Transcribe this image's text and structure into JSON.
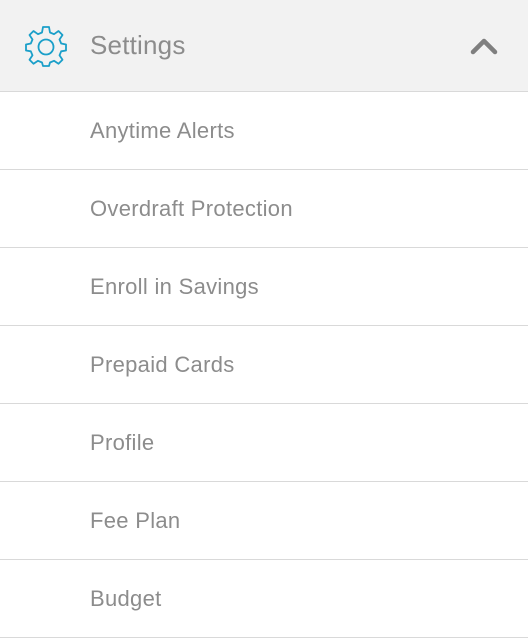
{
  "header": {
    "title": "Settings",
    "icon": "gear-icon",
    "toggle_icon": "chevron-up-icon",
    "expanded": true,
    "accent_color": "#1a9fc9"
  },
  "items": [
    {
      "label": "Anytime Alerts"
    },
    {
      "label": "Overdraft Protection"
    },
    {
      "label": "Enroll in Savings"
    },
    {
      "label": "Prepaid Cards"
    },
    {
      "label": "Profile"
    },
    {
      "label": "Fee Plan"
    },
    {
      "label": "Budget"
    }
  ]
}
